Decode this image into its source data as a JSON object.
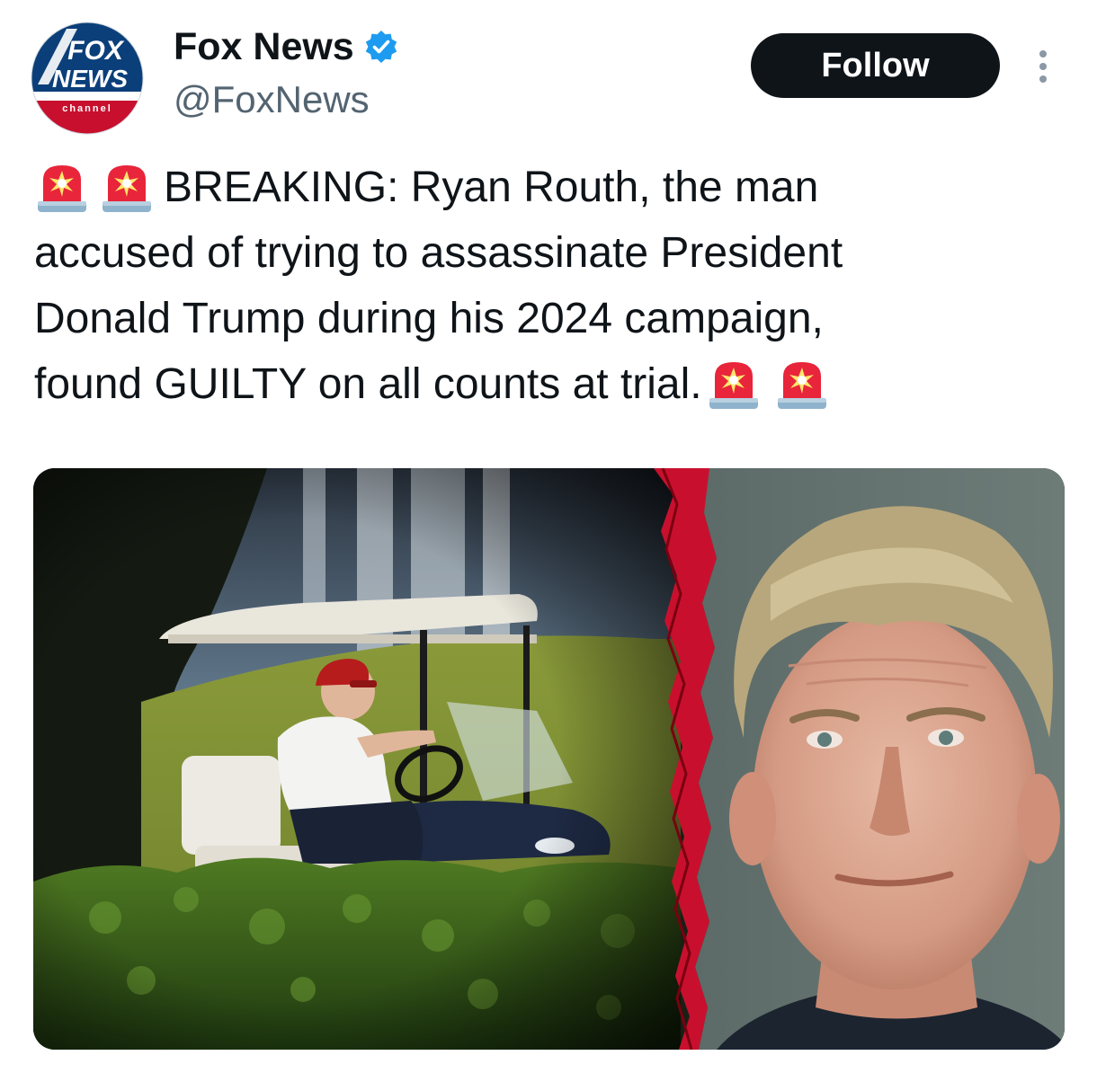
{
  "account": {
    "name": "Fox News",
    "handle": "@FoxNews",
    "verified": true,
    "avatar_logo": {
      "line1": "FOX",
      "line2": "NEWS",
      "line3": "channel"
    }
  },
  "actions": {
    "follow_label": "Follow",
    "more_icon": "more-vertical-icon"
  },
  "tweet": {
    "lines": [
      "BREAKING: Ryan Routh, the man",
      "accused of trying to assassinate President",
      "Donald Trump during his 2024 campaign,",
      "found GUILTY on all counts at trial."
    ],
    "emoji": "police-siren-emoji"
  },
  "media": {
    "left_panel": "photo-golf-cart",
    "right_panel": "photo-mugshot"
  },
  "colors": {
    "follow_bg": "#0f1419",
    "follow_text": "#ffffff",
    "handle": "#536471",
    "verified": "#1d9bf0",
    "fox_red": "#c8102e",
    "fox_blue": "#003366"
  }
}
